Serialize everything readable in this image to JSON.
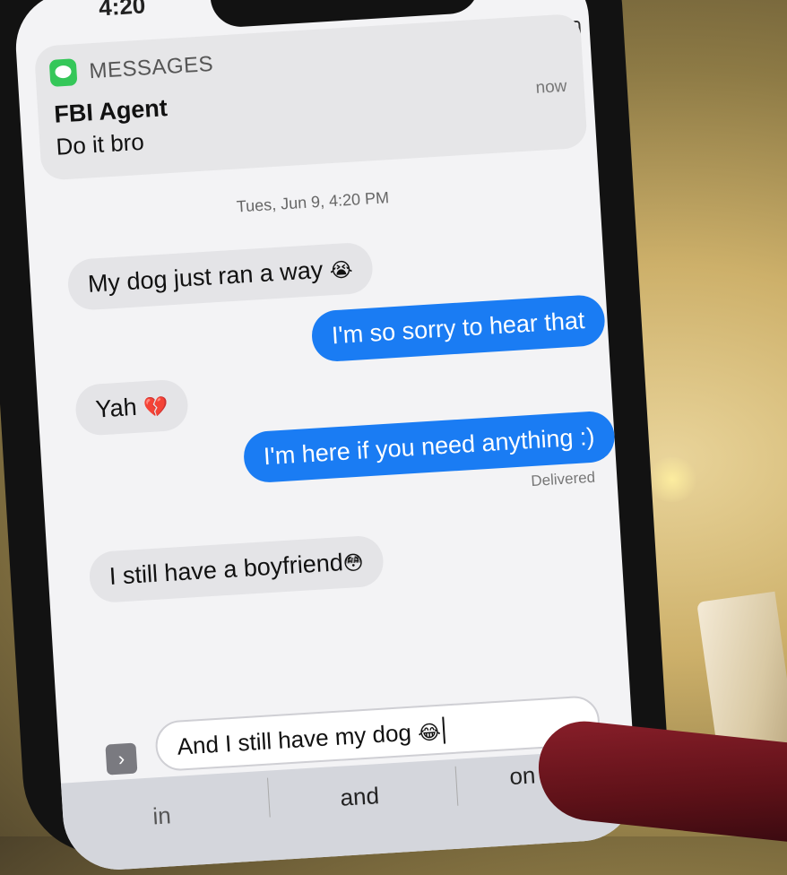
{
  "status_bar": {
    "time": "4:20"
  },
  "notification": {
    "app": "MESSAGES",
    "sender": "FBI Agent",
    "body": "Do it bro",
    "time": "now"
  },
  "thread": {
    "timestamp": "Tues, Jun 9, 4:20 PM",
    "messages": [
      {
        "from": "them",
        "text": "My dog just ran a way",
        "emoji": "😭"
      },
      {
        "from": "me",
        "text": "I'm so sorry to hear that",
        "emoji": ""
      },
      {
        "from": "them",
        "text": "Yah",
        "emoji": "💔"
      },
      {
        "from": "me",
        "text": "I'm here if you need anything :)",
        "emoji": ""
      },
      {
        "from": "them",
        "text": "I still have a boyfriend",
        "emoji": "😳"
      }
    ],
    "delivered_label": "Delivered"
  },
  "compose": {
    "value": "And I still have my dog",
    "emoji": "😂"
  },
  "keyboard": {
    "suggestions": [
      "in",
      "and",
      "on"
    ]
  }
}
